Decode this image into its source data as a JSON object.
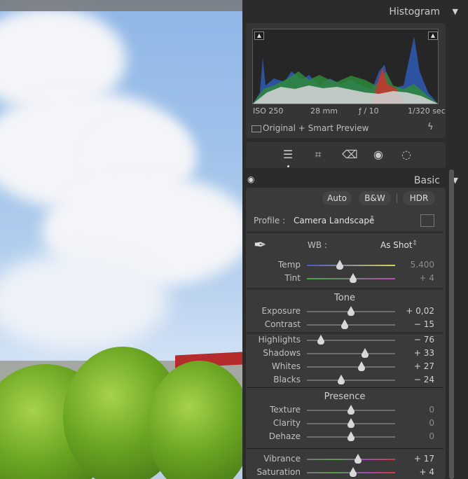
{
  "histogram": {
    "title": "Histogram",
    "iso": "ISO 250",
    "focal_length": "28 mm",
    "aperture": "ƒ / 10",
    "shutter": "1/320 sec",
    "preview_status": "Original + Smart Preview"
  },
  "tools": [
    "edit-sliders-icon",
    "crop-icon",
    "healing-eraser-icon",
    "redeye-icon",
    "masking-icon"
  ],
  "basic": {
    "title": "Basic",
    "buttons": {
      "auto": "Auto",
      "bw": "B&W",
      "hdr": "HDR"
    },
    "profile_label": "Profile :",
    "profile_value": "Camera Landscape",
    "wb_label": "WB :",
    "wb_value": "As Shot",
    "sliders": {
      "temp": {
        "label": "Temp",
        "value": "5.400",
        "position": 0.37
      },
      "tint": {
        "label": "Tint",
        "value": "+ 4",
        "position": 0.52
      },
      "exposure": {
        "label": "Exposure",
        "value": "+ 0,02",
        "position": 0.5
      },
      "contrast": {
        "label": "Contrast",
        "value": "− 15",
        "position": 0.43
      },
      "highlights": {
        "label": "Highlights",
        "value": "− 76",
        "position": 0.16
      },
      "shadows": {
        "label": "Shadows",
        "value": "+ 33",
        "position": 0.66
      },
      "whites": {
        "label": "Whites",
        "value": "+ 27",
        "position": 0.62
      },
      "blacks": {
        "label": "Blacks",
        "value": "− 24",
        "position": 0.39
      },
      "texture": {
        "label": "Texture",
        "value": "0",
        "position": 0.5
      },
      "clarity": {
        "label": "Clarity",
        "value": "0",
        "position": 0.5
      },
      "dehaze": {
        "label": "Dehaze",
        "value": "0",
        "position": 0.5
      },
      "vibrance": {
        "label": "Vibrance",
        "value": "+ 17",
        "position": 0.58
      },
      "saturation": {
        "label": "Saturation",
        "value": "+ 4",
        "position": 0.52
      }
    },
    "tone_title": "Tone",
    "presence_title": "Presence"
  }
}
